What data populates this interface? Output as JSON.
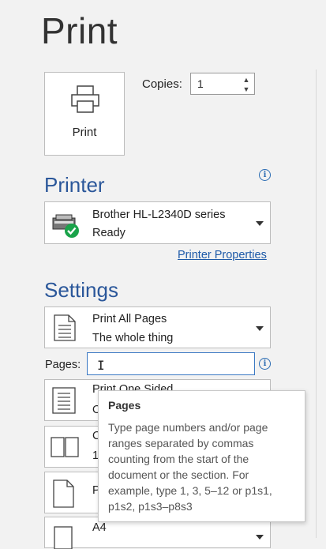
{
  "page": {
    "title": "Print"
  },
  "print_button": {
    "label": "Print"
  },
  "copies": {
    "label": "Copies:",
    "value": "1"
  },
  "printer": {
    "heading": "Printer",
    "name": "Brother HL-L2340D series",
    "status": "Ready",
    "properties_link": "Printer Properties"
  },
  "settings": {
    "heading": "Settings",
    "pages_dropdown": {
      "line1": "Print All Pages",
      "line2": "The whole thing"
    },
    "pages_label": "Pages:",
    "pages_value": "",
    "sided": {
      "line1": "Print One Sided",
      "line2": "O"
    },
    "collated": {
      "line1": "C",
      "line2": "1"
    },
    "orientation": {
      "line1": "P"
    },
    "paper_size": {
      "line1": "A4"
    }
  },
  "tooltip": {
    "title": "Pages",
    "body": "Type page numbers and/or page ranges separated by commas counting from the start of the document or the section. For example, type 1, 3, 5–12 or p1s1, p1s2, p1s3–p8s3"
  },
  "colors": {
    "accent": "#2b579a",
    "link": "#1e5aa8",
    "ready_green": "#1aa34a"
  }
}
